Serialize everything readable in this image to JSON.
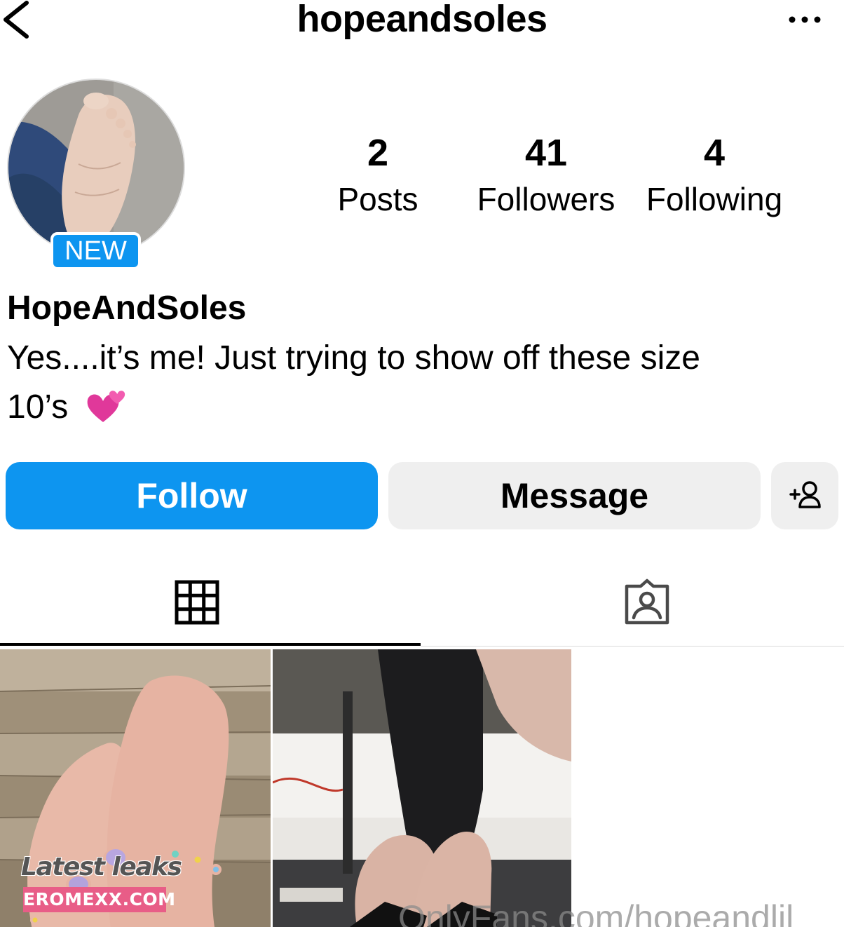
{
  "header": {
    "username": "hopeandsoles",
    "back_icon": "chevron-left-icon",
    "more_icon": "ellipsis-icon"
  },
  "profile": {
    "avatar_badge": "NEW",
    "stats": [
      {
        "value": "2",
        "label": "Posts"
      },
      {
        "value": "41",
        "label": "Followers"
      },
      {
        "value": "4",
        "label": "Following"
      }
    ],
    "display_name": "HopeAndSoles",
    "bio_line1": "Yes....it’s me! Just trying to show off these size",
    "bio_line2": "10’s",
    "bio_emoji": "two-hearts-icon"
  },
  "actions": {
    "follow_label": "Follow",
    "message_label": "Message",
    "suggest_icon": "add-person-icon"
  },
  "tabs": [
    {
      "name": "posts",
      "icon": "grid-icon",
      "selected": true
    },
    {
      "name": "tagged",
      "icon": "tagged-person-icon",
      "selected": false
    }
  ],
  "posts": [
    {
      "description": "Bare feet with pastel painted toenails on wood floor"
    },
    {
      "description": "Feet in black heels under a desk"
    }
  ],
  "watermarks": {
    "line1": "Latest leaks",
    "line2": "EROMEXX.COM",
    "onlyfans": "OnlyFans.com/hopeandlil"
  },
  "colors": {
    "accent": "#0d95f0",
    "button_gray": "#efefef",
    "badge_pink": "#e85d87"
  }
}
